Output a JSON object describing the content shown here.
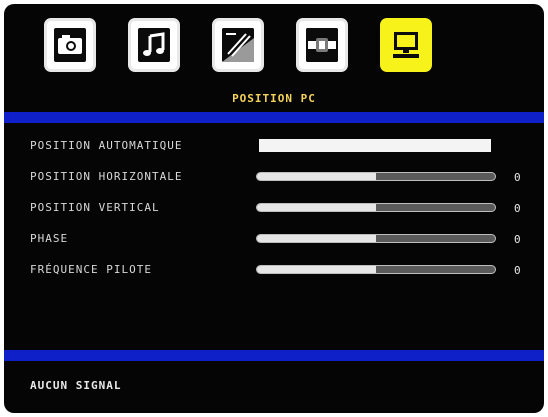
{
  "tabs": [
    {
      "icon": "camera-icon",
      "selected": false
    },
    {
      "icon": "music-note-icon",
      "selected": false
    },
    {
      "icon": "settings-slash-icon",
      "selected": false
    },
    {
      "icon": "source-connector-icon",
      "selected": false
    },
    {
      "icon": "pc-monitor-icon",
      "selected": true
    }
  ],
  "menu": {
    "title": "POSITION PC"
  },
  "rows": [
    {
      "label": "POSITION AUTOMATIQUE",
      "type": "action"
    },
    {
      "label": "POSITION HORIZONTALE",
      "type": "slider",
      "value": "0",
      "fill": 0.5
    },
    {
      "label": "POSITION VERTICAL",
      "type": "slider",
      "value": "0",
      "fill": 0.5
    },
    {
      "label": "PHASE",
      "type": "slider",
      "value": "0",
      "fill": 0.5
    },
    {
      "label": "FRÉQUENCE PILOTE",
      "type": "slider",
      "value": "0",
      "fill": 0.5
    }
  ],
  "status": {
    "text": "AUCUN SIGNAL"
  },
  "colors": {
    "background": "#050505",
    "band": "#1020c8",
    "title": "#f3d35a",
    "selected_tab": "#f6f21a"
  }
}
